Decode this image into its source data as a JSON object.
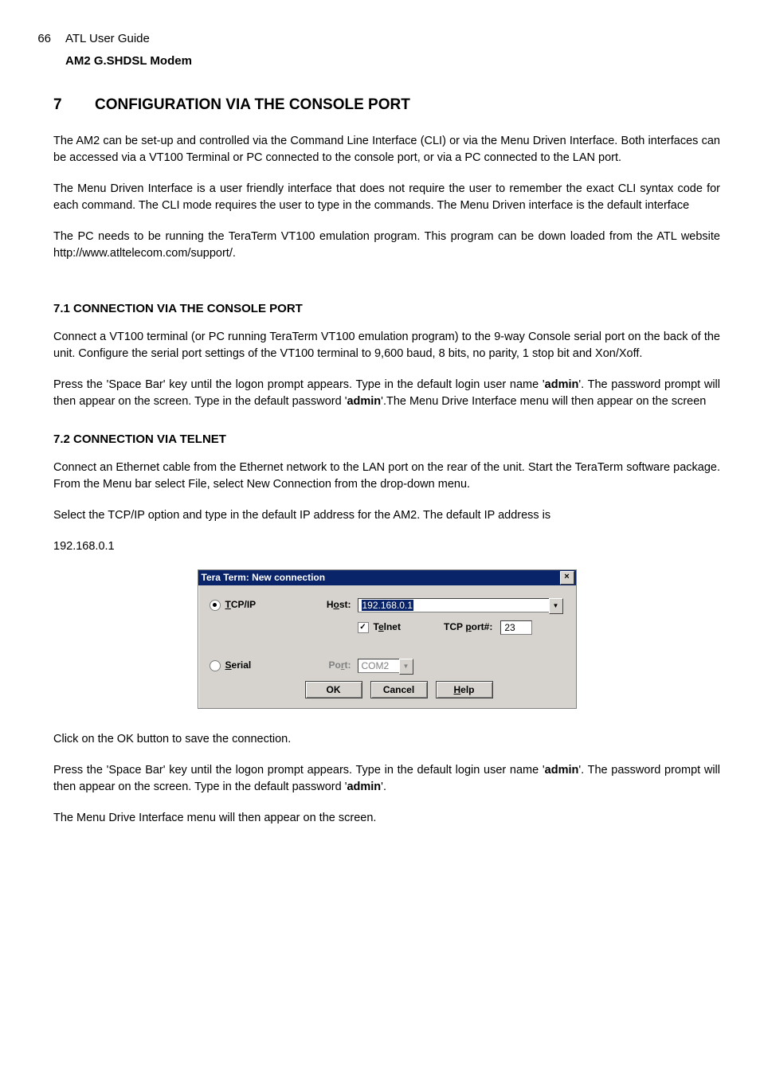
{
  "header": {
    "page_number": "66",
    "doc_title": "ATL User Guide",
    "doc_subtitle": "AM2 G.SHDSL Modem"
  },
  "chapter": {
    "number": "7",
    "title": "CONFIGURATION VIA THE CONSOLE PORT"
  },
  "p1": "The AM2 can be set-up and controlled via the Command Line Interface (CLI) or via the Menu Driven Interface. Both interfaces can be accessed via a VT100 Terminal or PC connected to the console port, or via a PC connected to the LAN port.",
  "p2": "The Menu Driven Interface is a user friendly interface that does not require the user to remember the exact CLI syntax code for each command. The CLI mode requires the user to type in the commands. The Menu Driven interface is the default interface",
  "p3": "The PC needs to be running the TeraTerm VT100 emulation program. This program can be down loaded from the ATL website http://www.atltelecom.com/support/.",
  "s71": {
    "heading": "7.1 CONNECTION VIA THE CONSOLE PORT"
  },
  "p4": "Connect a VT100 terminal (or PC running TeraTerm VT100 emulation program) to the 9-way Console serial port on the back of the unit. Configure the serial port settings of the VT100 terminal to 9,600 baud, 8 bits, no parity, 1 stop bit and Xon/Xoff.",
  "p5a": "Press the 'Space Bar' key until the logon prompt appears. Type in the default login user name '",
  "p5b": "admin",
  "p5c": "'. The password prompt will then appear on the screen. Type in the default password '",
  "p5d": "admin",
  "p5e": "'.The Menu Drive Interface menu will then appear on the screen",
  "s72": {
    "heading": "7.2 CONNECTION VIA TELNET"
  },
  "p6": "Connect an Ethernet cable from the Ethernet network to the LAN port on the rear of the unit. Start the TeraTerm software package. From the Menu bar select File, select New Connection from the drop-down menu.",
  "p7": "Select the TCP/IP option and type in the default IP address for the AM2. The default IP address is",
  "p8": "192.168.0.1",
  "dialog": {
    "title": "Tera Term: New connection",
    "close": "×",
    "tcpip_label": "TCP/IP",
    "serial_label": "Serial",
    "host_label": "Host:",
    "host_value": "192.168.0.1",
    "telnet_label": "Telnet",
    "tcp_port_label": "TCP port#:",
    "tcp_port_value": "23",
    "port_label": "Port:",
    "port_value": "COM2",
    "ok": "OK",
    "cancel": "Cancel",
    "help": "Help",
    "checkmark": "✓",
    "dropdown_arrow": "▼"
  },
  "p9": "Click on the OK button to save the connection.",
  "p10a": "Press the 'Space Bar' key until the logon prompt appears. Type in the default login user name '",
  "p10b": "admin",
  "p10c": "'. The password prompt will then appear on the screen. Type in the default password '",
  "p10d": "admin",
  "p10e": "'.",
  "p11": "The Menu Drive Interface menu will then appear on the screen."
}
